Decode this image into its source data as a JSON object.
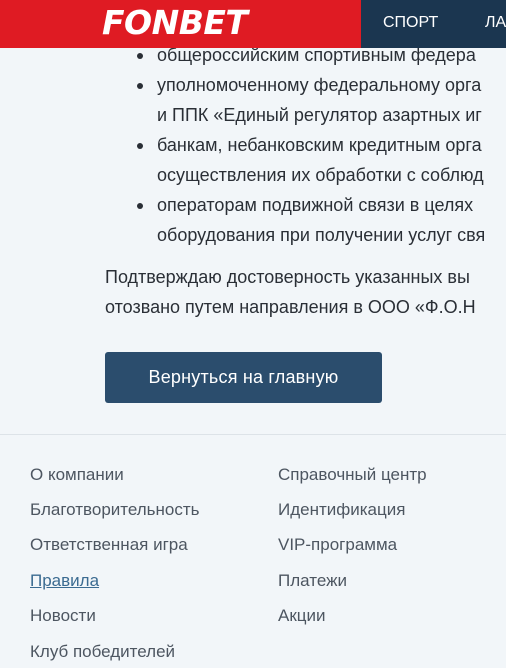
{
  "header": {
    "logo": "FONBET",
    "nav": [
      "СПОРТ",
      "ЛА"
    ]
  },
  "bullets": [
    {
      "lines": [
        "общероссийским спортивным федера"
      ]
    },
    {
      "lines": [
        "уполномоченному федеральному орга",
        "и ППК «Единый регулятор азартных иг"
      ]
    },
    {
      "lines": [
        "банкам, небанковским кредитным орга",
        "осуществления их обработки с соблюд"
      ]
    },
    {
      "lines": [
        "операторам подвижной связи в целях",
        "оборудования при получении услуг свя"
      ]
    }
  ],
  "confirm": {
    "line1": "Подтверждаю достоверность указанных вы",
    "line2": "отозвано путем направления в ООО «Ф.О.Н"
  },
  "button": {
    "home_label": "Вернуться на главную"
  },
  "footer": {
    "col1": [
      "О компании",
      "Благотворительность",
      "Ответственная игра",
      "Правила",
      "Новости",
      "Клуб победителей"
    ],
    "col2": [
      "Справочный центр",
      "Идентификация",
      "VIP-программа",
      "Платежи",
      "Акции"
    ]
  },
  "colors": {
    "brand_red": "#df1b23",
    "header_navy": "#1b3650",
    "button_blue": "#2b4d6d",
    "link_active": "#3b6b91"
  }
}
